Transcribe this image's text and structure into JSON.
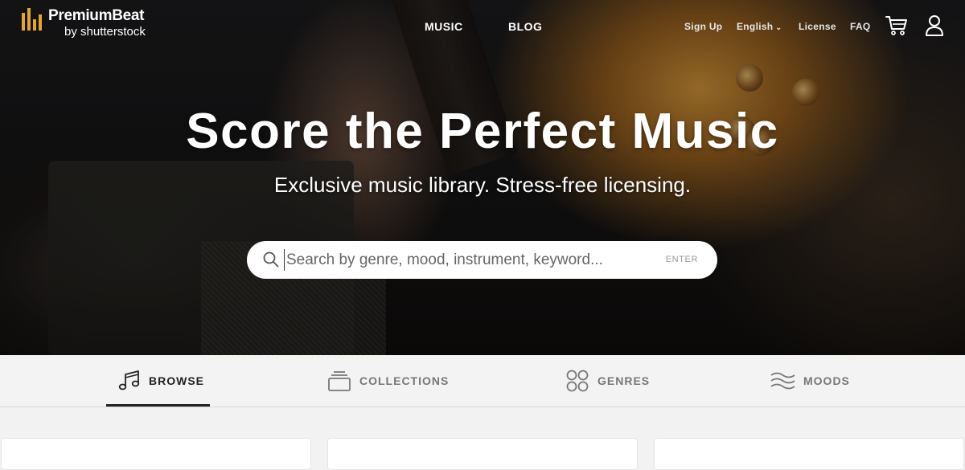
{
  "brand": {
    "name": "PremiumBeat",
    "sub": "by shutterstock",
    "accent_color": "#e3a533"
  },
  "nav": {
    "main": [
      "MUSIC",
      "BLOG"
    ],
    "sign_up": "Sign Up",
    "language": "English",
    "license": "License",
    "faq": "FAQ",
    "icons": [
      "cart-icon",
      "user-icon"
    ]
  },
  "hero": {
    "title": "Score the Perfect Music",
    "subtitle": "Exclusive music library. Stress-free licensing.",
    "search": {
      "placeholder": "Search by genre, mood, instrument, keyword...",
      "value": "",
      "enter_label": "ENTER"
    }
  },
  "tabs": [
    {
      "label": "BROWSE",
      "icon": "music-note-icon",
      "active": true
    },
    {
      "label": "COLLECTIONS",
      "icon": "collections-icon",
      "active": false
    },
    {
      "label": "GENRES",
      "icon": "genres-icon",
      "active": false
    },
    {
      "label": "MOODS",
      "icon": "waves-icon",
      "active": false
    }
  ]
}
